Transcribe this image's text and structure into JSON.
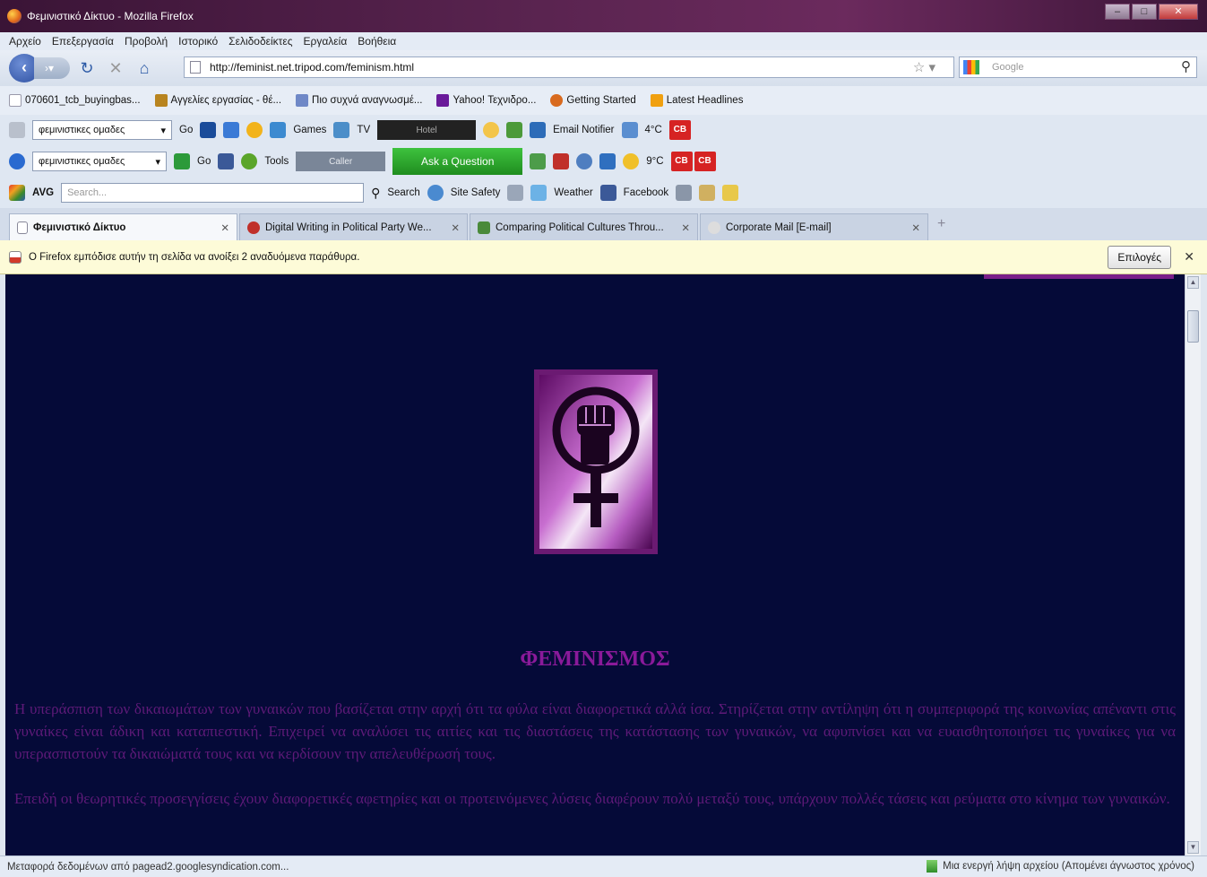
{
  "window": {
    "title": "Φεμινιστικό Δίκτυο - Mozilla Firefox"
  },
  "menu": [
    "Αρχείο",
    "Επεξεργασία",
    "Προβολή",
    "Ιστορικό",
    "Σελιδοδείκτες",
    "Εργαλεία",
    "Βοήθεια"
  ],
  "nav": {
    "url": "http://feminist.net.tripod.com/feminism.html",
    "search_placeholder": "Google"
  },
  "bookmarks": [
    {
      "label": "070601_tcb_buyingbas...",
      "color": "#dfe6f0"
    },
    {
      "label": "Αγγελίες εργασίας - θέ...",
      "color": "#b8841f"
    },
    {
      "label": "Πιο συχνά αναγνωσμέ...",
      "color": "#6f88c7"
    },
    {
      "label": "Yahoo! Τεχνιδρο...",
      "color": "#6a1a9a"
    },
    {
      "label": "Getting Started",
      "color": "#d86a1f"
    },
    {
      "label": "Latest Headlines",
      "color": "#f0a010"
    }
  ],
  "toolbar1": {
    "combo": "φεμινιστικες ομαδες",
    "go": "Go",
    "games": "Games",
    "tv": "TV",
    "radio": "Hotel",
    "email": "Email Notifier",
    "temp": "4°C",
    "cb": "CB"
  },
  "toolbar2": {
    "combo": "φεμινιστικες ομαδες",
    "go": "Go",
    "tools": "Tools",
    "radio": "Caller",
    "ask": "Ask a Question",
    "temp": "9°C",
    "cb1": "CB",
    "cb2": "CB"
  },
  "toolbar3": {
    "brand": "AVG",
    "search_placeholder": "Search...",
    "search": "Search",
    "site_safety": "Site Safety",
    "weather": "Weather",
    "facebook": "Facebook"
  },
  "tabs": [
    {
      "label": "Φεμινιστικό Δίκτυο",
      "active": true
    },
    {
      "label": "Digital Writing in Political Party We...",
      "active": false
    },
    {
      "label": "Comparing Political Cultures Throu...",
      "active": false
    },
    {
      "label": "Corporate Mail [E-mail]",
      "active": false
    }
  ],
  "notification": {
    "text": "Ο Firefox εμπόδισε αυτήν τη σελίδα να ανοίξει 2 αναδυόμενα παράθυρα.",
    "button": "Επιλογές"
  },
  "page": {
    "heading": "ΦΕΜΙΝΙΣΜΟΣ",
    "paragraph1": "Η υπεράσπιση των δικαιωμάτων των γυναικών που βασίζεται στην αρχή ότι τα φύλα είναι διαφορετικά αλλά ίσα. Στηρίζεται στην αντίληψη ότι η συμπεριφορά της κοινωνίας απέναντι στις γυναίκες είναι άδικη και καταπιεστική. Επιχειρεί να αναλύσει τις αιτίες και τις διαστάσεις της κατάστασης των γυναικών, να αφυπνίσει και να ευαισθητοποιήσει τις γυναίκες για να υπερασπιστούν τα δικαιώματά τους και να κερδίσουν την απελευθέρωσή τους.",
    "paragraph2": "Επειδή οι θεωρητικές προσεγγίσεις έχουν διαφορετικές αφετηρίες και οι προτεινόμενες λύσεις διαφέρουν πολύ μεταξύ τους, υπάρχουν πολλές τάσεις και ρεύματα στο κίνημα των γυναικών."
  },
  "status": {
    "left": "Μεταφορά δεδομένων από pagead2.googlesyndication.com...",
    "right": "Μια ενεργή λήψη αρχείου (Απομένει άγνωστος χρόνος)"
  },
  "colors": {
    "page_bg": "#050a38",
    "accent": "#8a1a9a",
    "body_text": "#5e1a78"
  }
}
